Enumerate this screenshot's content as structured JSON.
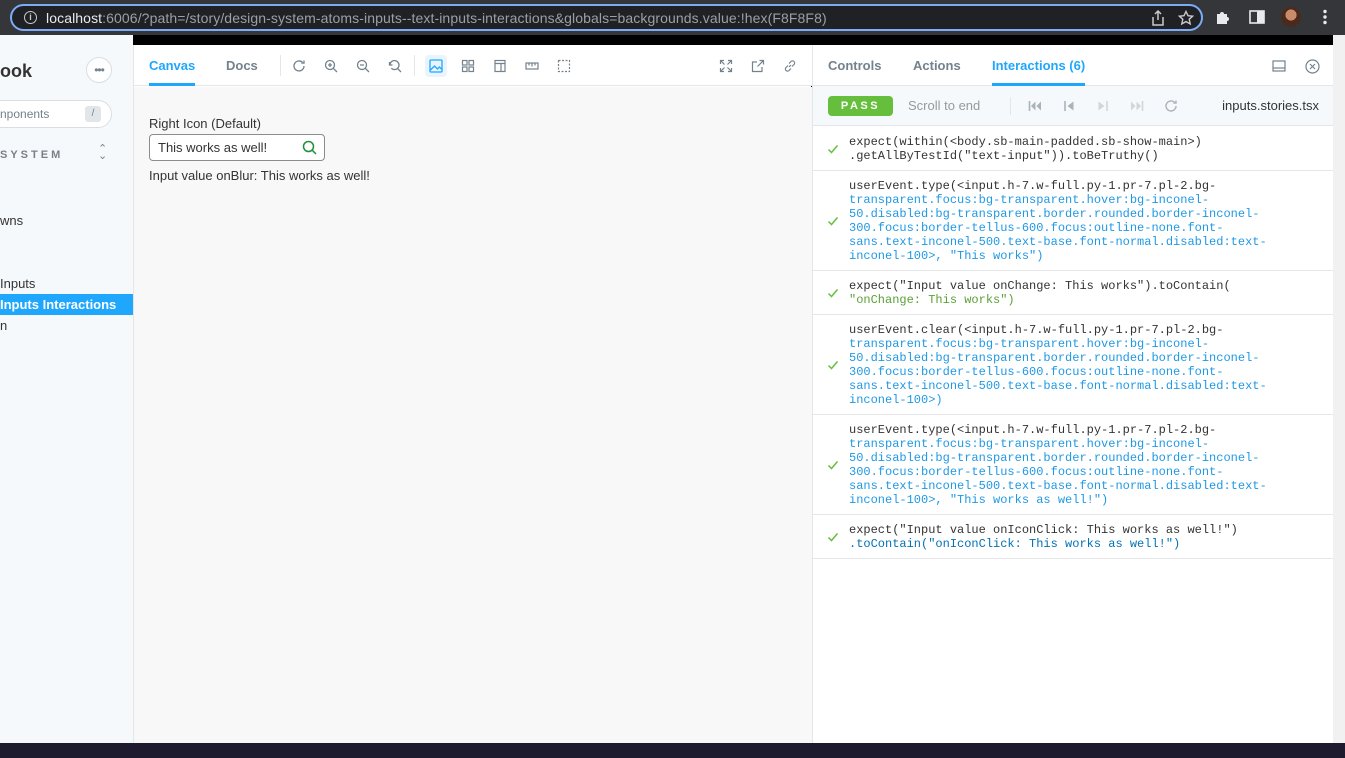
{
  "browser": {
    "url_host": "localhost",
    "url_rest": ":6006/?path=/story/design-system-atoms-inputs--text-inputs-interactions&globals=backgrounds.value:!hex(F8F8F8)"
  },
  "sidebar": {
    "title": "ook",
    "more_icon": "ellipsis-icon",
    "search_placeholder": "nponents",
    "search_shortcut": "/",
    "group_label": "SYSTEM",
    "items": [
      {
        "label": "wns"
      },
      {
        "label": "Inputs"
      },
      {
        "label": "Inputs Interactions"
      },
      {
        "label": "n"
      }
    ]
  },
  "toolbar": {
    "tabs": [
      {
        "label": "Canvas"
      },
      {
        "label": "Docs"
      }
    ]
  },
  "story": {
    "label": "Right Icon (Default)",
    "input_value": "This works as well!",
    "output_text": "Input value onBlur: This works as well!"
  },
  "panel": {
    "tabs": [
      {
        "label": "Controls"
      },
      {
        "label": "Actions"
      },
      {
        "label": "Interactions (6)"
      }
    ],
    "status": "PASS",
    "scroll_to_end": "Scroll to end",
    "story_file": "inputs.stories.tsx",
    "steps": [
      {
        "lines": [
          "expect(within(<body.sb-main-padded.sb-show-main>)",
          ".getAllByTestId(\"text-input\")).toBeTruthy()"
        ]
      },
      {
        "lines": [
          "userEvent.type(<input.h-7.w-full.py-1.pr-7.pl-2.bg-",
          "transparent.focus:bg-transparent.hover:bg-inconel-",
          "50.disabled:bg-transparent.border.rounded.border-inconel-",
          "300.focus:border-tellus-600.focus:outline-none.font-",
          "sans.text-inconel-500.text-base.font-normal.disabled:text-",
          "inconel-100>, \"This works\")"
        ]
      },
      {
        "lines": [
          "expect(\"Input value onChange: This works\").toContain(",
          "\"onChange: This works\")"
        ]
      },
      {
        "lines": [
          "userEvent.clear(<input.h-7.w-full.py-1.pr-7.pl-2.bg-",
          "transparent.focus:bg-transparent.hover:bg-inconel-",
          "50.disabled:bg-transparent.border.rounded.border-inconel-",
          "300.focus:border-tellus-600.focus:outline-none.font-",
          "sans.text-inconel-500.text-base.font-normal.disabled:text-",
          "inconel-100>)"
        ]
      },
      {
        "lines": [
          "userEvent.type(<input.h-7.w-full.py-1.pr-7.pl-2.bg-",
          "transparent.focus:bg-transparent.hover:bg-inconel-",
          "50.disabled:bg-transparent.border.rounded.border-inconel-",
          "300.focus:border-tellus-600.focus:outline-none.font-",
          "sans.text-inconel-500.text-base.font-normal.disabled:text-",
          "inconel-100>, \"This works as well!\")"
        ]
      },
      {
        "lines": [
          "expect(\"Input value onIconClick: This works as well!\")",
          ".toContain(\"onIconClick: This works as well!\")"
        ]
      }
    ]
  },
  "colors": {
    "accent": "#1ea7fd",
    "pass": "#66bf3c"
  }
}
